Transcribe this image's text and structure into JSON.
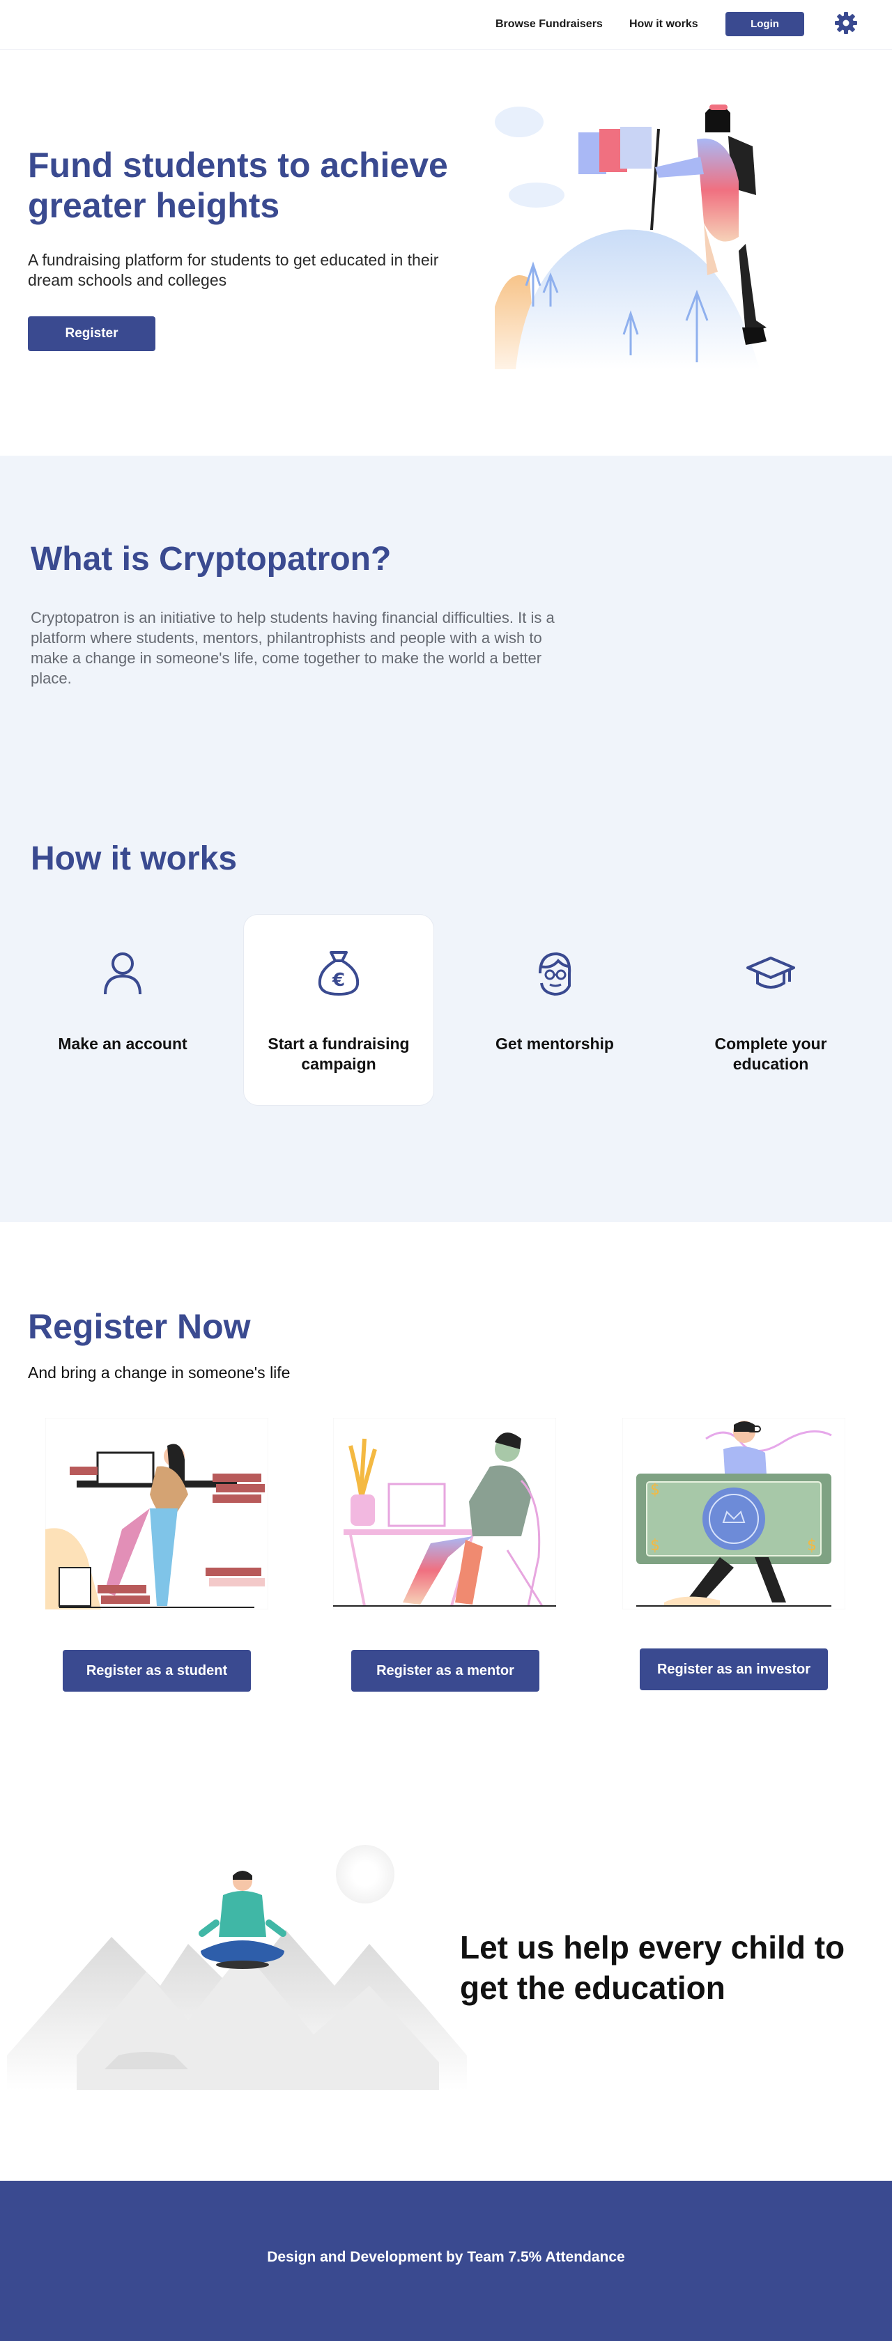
{
  "nav": {
    "browse": "Browse Fundraisers",
    "how": "How it works",
    "login": "Login",
    "settings_icon": "gear-icon"
  },
  "hero": {
    "title": "Fund students to achieve greater heights",
    "subtitle": "A fundraising platform for students to get educated in their dream schools and colleges",
    "register": "Register"
  },
  "about": {
    "title": "What is Cryptopatron?",
    "text": "Cryptopatron is an initiative to help students having financial difficulties. It is a platform where students, mentors, philantrophists and people with a wish to make a change in someone's life, come together to make the world a better place."
  },
  "how": {
    "title": "How it works",
    "steps": [
      {
        "label": "Make an account",
        "icon": "user-icon"
      },
      {
        "label": "Start a fundraising campaign",
        "icon": "money-bag-euro-icon"
      },
      {
        "label": "Get mentorship",
        "icon": "mentor-icon"
      },
      {
        "label": "Complete your education",
        "icon": "graduation-cap-icon"
      }
    ]
  },
  "register": {
    "title": "Register Now",
    "subtitle": "And bring a change in someone's life",
    "student": "Register as a student",
    "mentor": "Register as a mentor",
    "investor": "Register as an investor"
  },
  "cta": {
    "text": "Let us help every child to get the education"
  },
  "footer": {
    "text": "Design and Development by Team 7.5% Attendance"
  },
  "colors": {
    "brand": "#3a4a90",
    "band": "#f0f4fa",
    "footer": "#3a4a90"
  }
}
